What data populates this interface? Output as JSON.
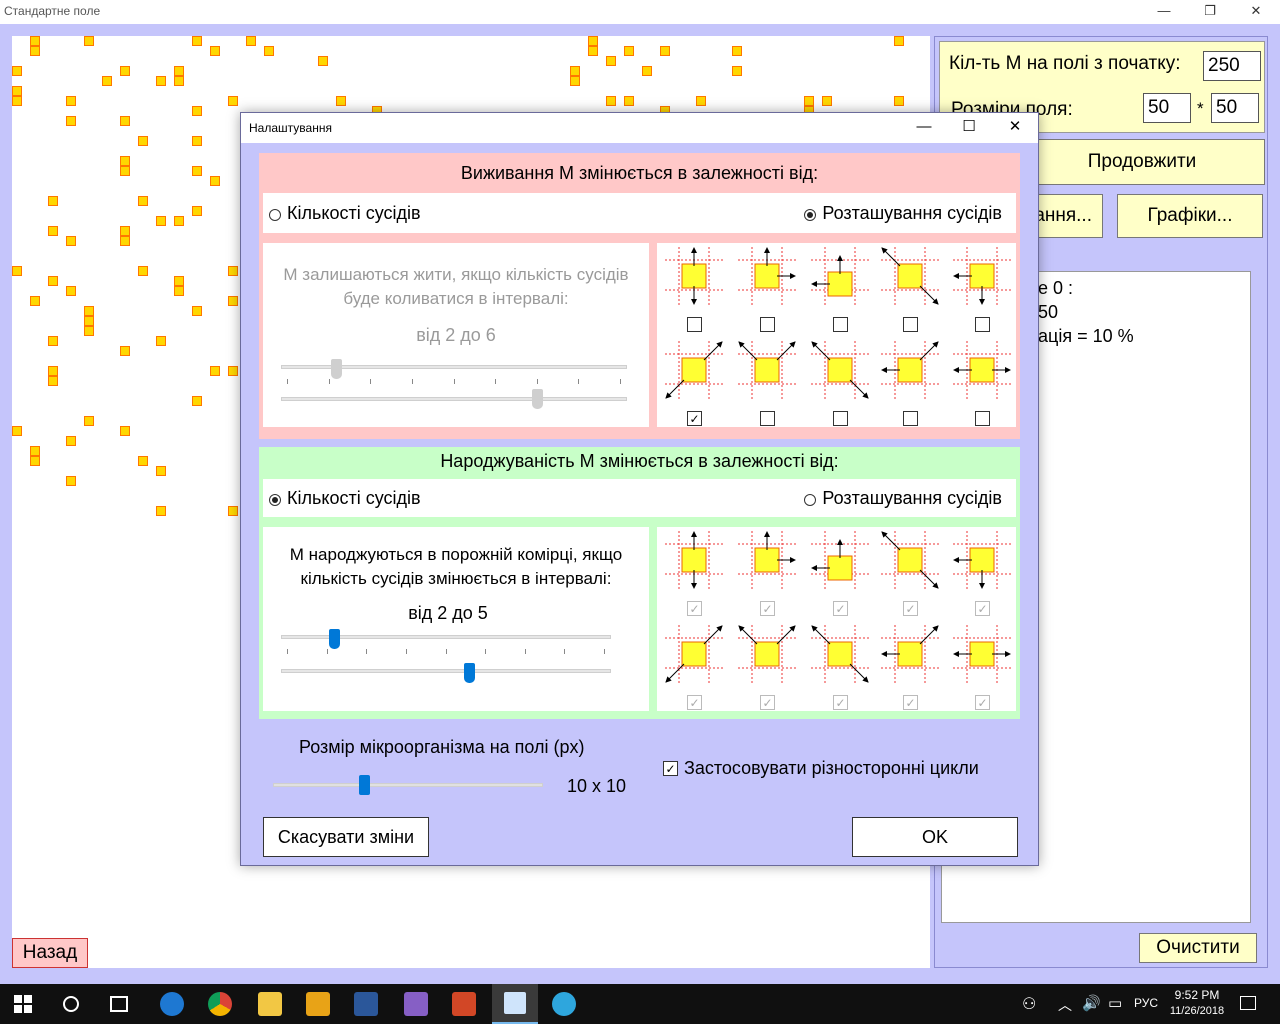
{
  "main_window": {
    "title": "Стандартне поле",
    "minimize": "—",
    "maximize": "❐",
    "close": "✕"
  },
  "right_panel": {
    "initial_count_label": "Кіл-ть М на полі з початку:",
    "initial_count_value": "250",
    "field_size_label": "Розміри поля:",
    "field_w": "50",
    "field_times": "*",
    "field_h": "50",
    "continue_button": "Продовжити",
    "settings_button": "ання...",
    "charts_button": "Графіки...",
    "stats_line1": "е 0 :",
    "stats_line2": "50",
    "stats_line3": "ація = 10 %",
    "clear_button": "Очистити"
  },
  "back_button": "Назад",
  "dialog": {
    "title": "Налаштування",
    "minimize": "—",
    "maximize": "☐",
    "close": "✕",
    "survival": {
      "heading": "Виживання М змінюється в залежності від:",
      "option_count": "Кількості сусідів",
      "option_position": "Розташування сусідів",
      "selected": "position",
      "desc": "М залишаються жити, якщо кількість сусідів буде коливатися в інтервалі:",
      "range_text": "від 2 до 6",
      "range_min": 2,
      "range_max": 6,
      "checks": [
        false,
        false,
        false,
        false,
        false,
        true,
        false,
        false,
        false,
        false
      ]
    },
    "birth": {
      "heading": "Народжуваність М змінюється в залежності від:",
      "option_count": "Кількості сусідів",
      "option_position": "Розташування сусідів",
      "selected": "count",
      "desc": "М народжуються в порожній комірці, якщо кількість сусідів змінюється в інтервалі:",
      "range_text": "від 2 до 5",
      "range_min": 2,
      "range_max": 5,
      "checks": [
        true,
        true,
        true,
        true,
        true,
        true,
        true,
        true,
        true,
        true
      ]
    },
    "size_label": "Розмір мікроорганізма на полі (px)",
    "size_value": "10 x 10",
    "size_level": 10,
    "cycles_label": "Застосовувати різносторонні цикли",
    "cycles_checked": true,
    "cancel_button": "Скасувати зміни",
    "ok_button": "OK"
  },
  "taskbar": {
    "lang": "РУС",
    "time": "9:52 PM",
    "date": "11/26/2018"
  },
  "colors": {
    "background": "#c5c5fb",
    "cell_fill": "#ffd700",
    "cell_border": "#ff7700",
    "survival_bg": "#ffc8c8",
    "birth_bg": "#c8ffc8",
    "yellow_panel": "#ffffc8",
    "slider_blue": "#0078d7"
  }
}
